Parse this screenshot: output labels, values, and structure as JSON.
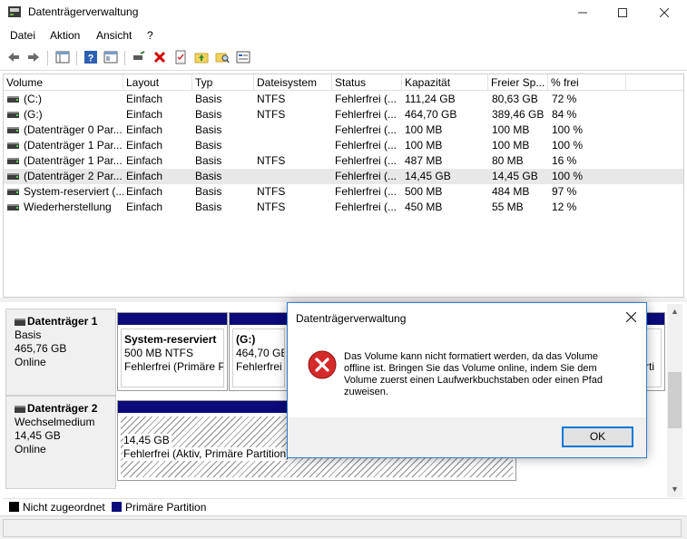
{
  "window": {
    "title": "Datenträgerverwaltung"
  },
  "menu": {
    "items": [
      "Datei",
      "Aktion",
      "Ansicht",
      "?"
    ]
  },
  "toolbar": {
    "icons": [
      "back-arrow-icon",
      "forward-arrow-icon",
      "console-tree-icon",
      "help-icon",
      "properties-icon",
      "connect-icon",
      "delete-icon",
      "checklist-icon",
      "folder-up-icon",
      "search-folder-icon",
      "wizard-icon"
    ]
  },
  "volume_list": {
    "columns": [
      "Volume",
      "Layout",
      "Typ",
      "Dateisystem",
      "Status",
      "Kapazität",
      "Freier Sp...",
      "% frei"
    ],
    "rows": [
      {
        "volume": "(C:)",
        "layout": "Einfach",
        "typ": "Basis",
        "fs": "NTFS",
        "status": "Fehlerfrei (...",
        "kap": "111,24 GB",
        "frei": "80,63 GB",
        "pct": "72 %"
      },
      {
        "volume": "(G:)",
        "layout": "Einfach",
        "typ": "Basis",
        "fs": "NTFS",
        "status": "Fehlerfrei (...",
        "kap": "464,70 GB",
        "frei": "389,46 GB",
        "pct": "84 %"
      },
      {
        "volume": "(Datenträger 0 Par...",
        "layout": "Einfach",
        "typ": "Basis",
        "fs": "",
        "status": "Fehlerfrei (...",
        "kap": "100 MB",
        "frei": "100 MB",
        "pct": "100 %"
      },
      {
        "volume": "(Datenträger 1 Par...",
        "layout": "Einfach",
        "typ": "Basis",
        "fs": "",
        "status": "Fehlerfrei (...",
        "kap": "100 MB",
        "frei": "100 MB",
        "pct": "100 %"
      },
      {
        "volume": "(Datenträger 1 Par...",
        "layout": "Einfach",
        "typ": "Basis",
        "fs": "NTFS",
        "status": "Fehlerfrei (...",
        "kap": "487 MB",
        "frei": "80 MB",
        "pct": "16 %"
      },
      {
        "volume": "(Datenträger 2 Par...",
        "layout": "Einfach",
        "typ": "Basis",
        "fs": "",
        "status": "Fehlerfrei (...",
        "kap": "14,45 GB",
        "frei": "14,45 GB",
        "pct": "100 %"
      },
      {
        "volume": "System-reserviert (...",
        "layout": "Einfach",
        "typ": "Basis",
        "fs": "NTFS",
        "status": "Fehlerfrei (...",
        "kap": "500 MB",
        "frei": "484 MB",
        "pct": "97 %"
      },
      {
        "volume": "Wiederherstellung",
        "layout": "Einfach",
        "typ": "Basis",
        "fs": "NTFS",
        "status": "Fehlerfrei (...",
        "kap": "450 MB",
        "frei": "55 MB",
        "pct": "12 %"
      }
    ]
  },
  "disks": [
    {
      "name": "Datenträger 1",
      "type": "Basis",
      "size": "465,76 GB",
      "state": "Online",
      "partitions": [
        {
          "name": "System-reserviert",
          "size": "500 MB NTFS",
          "status": "Fehlerfrei (Primäre P"
        },
        {
          "name": "(G:)",
          "size": "464,70 GB",
          "status": "Fehlerfrei ("
        },
        {
          "name": "",
          "size": "",
          "status": "rti"
        }
      ]
    },
    {
      "name": "Datenträger 2",
      "type": "Wechselmedium",
      "size": "14,45 GB",
      "state": "Online",
      "partitions": [
        {
          "name": "",
          "size": "14,45 GB",
          "status": "Fehlerfrei (Aktiv, Primäre Partition)"
        }
      ]
    }
  ],
  "legend": [
    {
      "label": "Nicht zugeordnet",
      "color": "#000000"
    },
    {
      "label": "Primäre Partition",
      "color": "#0a0a7a"
    }
  ],
  "dialog": {
    "title": "Datenträgerverwaltung",
    "message": "Das Volume kann nicht formatiert werden, da das Volume offline ist. Bringen Sie das Volume online, indem Sie dem Volume zuerst einen Laufwerkbuchstaben oder einen Pfad zuweisen.",
    "ok_label": "OK",
    "icon": "error-icon"
  }
}
